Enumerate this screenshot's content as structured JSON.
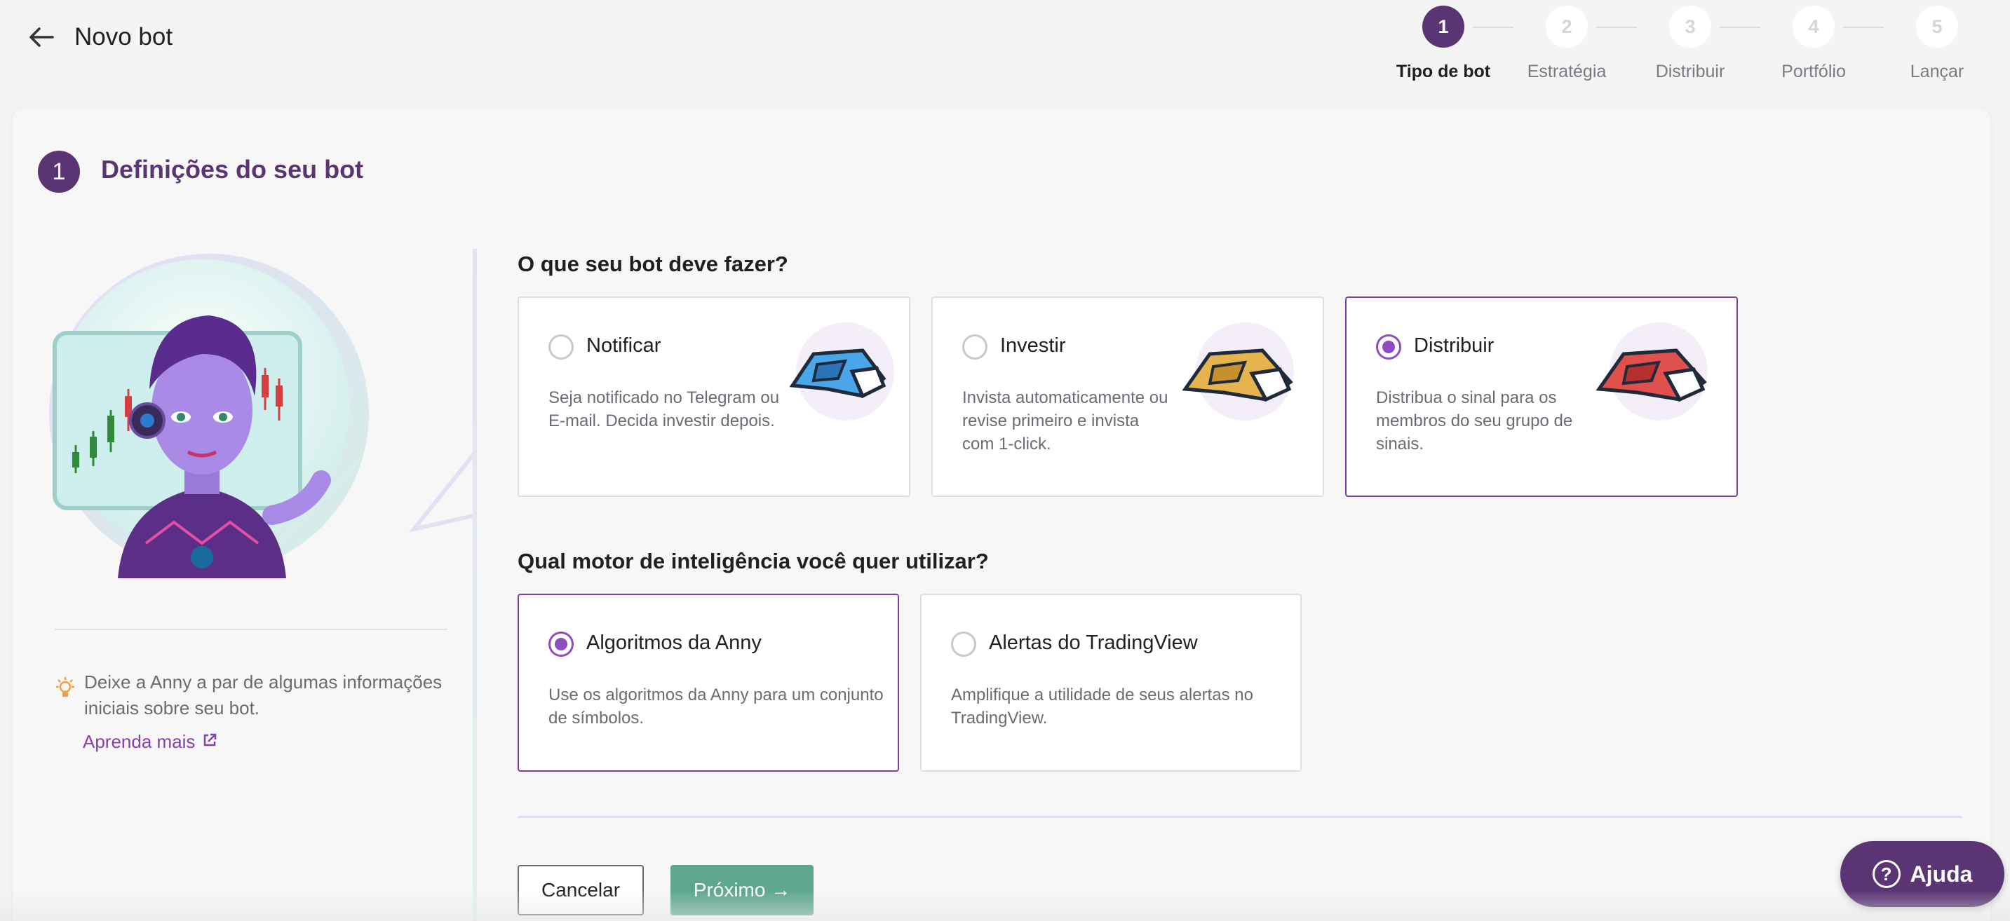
{
  "header": {
    "title": "Novo bot"
  },
  "stepper": [
    {
      "num": "1",
      "label": "Tipo de bot",
      "active": true
    },
    {
      "num": "2",
      "label": "Estratégia",
      "active": false
    },
    {
      "num": "3",
      "label": "Distribuir",
      "active": false
    },
    {
      "num": "4",
      "label": "Portfólio",
      "active": false
    },
    {
      "num": "5",
      "label": "Lançar",
      "active": false
    }
  ],
  "section": {
    "num": "1",
    "title": "Definições do seu bot"
  },
  "tip": {
    "text": "Deixe a Anny a par de algumas informações iniciais sobre seu bot.",
    "link": "Aprenda mais"
  },
  "question1": {
    "title": "O que seu bot deve fazer?",
    "options": [
      {
        "title": "Notificar",
        "desc": "Seja notificado no Telegram ou E-mail. Decida investir depois.",
        "selected": false,
        "color": "#4aa6e8"
      },
      {
        "title": "Investir",
        "desc": "Invista automaticamente ou revise primeiro e invista com 1-click.",
        "selected": false,
        "color": "#e5b44e"
      },
      {
        "title": "Distribuir",
        "desc": "Distribua o sinal para os membros do seu grupo de sinais.",
        "selected": true,
        "color": "#e0504d"
      }
    ]
  },
  "question2": {
    "title": "Qual motor de inteligência você quer utilizar?",
    "options": [
      {
        "title": "Algoritmos da Anny",
        "desc": "Use os algoritmos da Anny para um conjunto de símbolos.",
        "selected": true
      },
      {
        "title": "Alertas do TradingView",
        "desc": "Amplifique a utilidade de seus alertas no TradingView.",
        "selected": false
      }
    ]
  },
  "buttons": {
    "cancel": "Cancelar",
    "next": "Próximo →",
    "help": "Ajuda",
    "help_icon": "?"
  },
  "colors": {
    "brand": "#5b3573",
    "accent": "#8e4cc0",
    "primary_button": "#5ea78d"
  }
}
